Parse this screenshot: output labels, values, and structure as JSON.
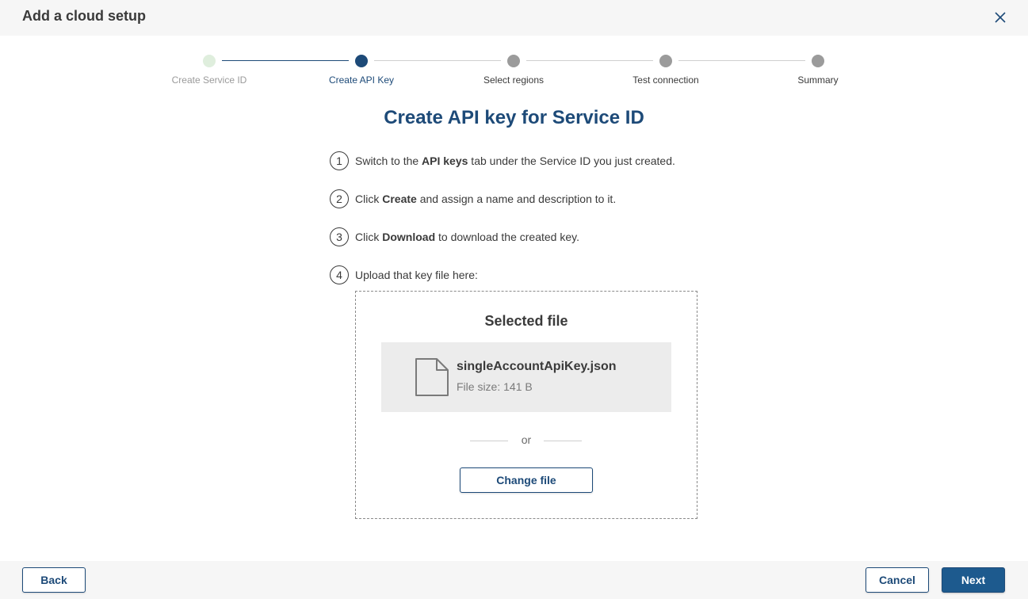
{
  "header": {
    "title": "Add a cloud setup",
    "close_icon": "close-icon"
  },
  "stepper": {
    "steps": [
      {
        "label": "Create Service ID",
        "state": "done"
      },
      {
        "label": "Create API Key",
        "state": "active"
      },
      {
        "label": "Select regions",
        "state": "pending"
      },
      {
        "label": "Test connection",
        "state": "pending"
      },
      {
        "label": "Summary",
        "state": "pending"
      }
    ]
  },
  "main": {
    "title": "Create API key for Service ID",
    "instructions": [
      {
        "number": "1",
        "pre": "Switch to the ",
        "bold": "API keys",
        "post": " tab under the Service ID you just created."
      },
      {
        "number": "2",
        "pre": "Click ",
        "bold": "Create",
        "post": " and assign a name and description to it."
      },
      {
        "number": "3",
        "pre": "Click ",
        "bold": "Download",
        "post": " to download the created key."
      },
      {
        "number": "4",
        "pre": "Upload that key file here:",
        "bold": "",
        "post": ""
      }
    ],
    "upload": {
      "title": "Selected file",
      "file_icon": "file-icon",
      "file_name": "singleAccountApiKey.json",
      "file_size": "File size: 141 B",
      "or_text": "or",
      "change_button": "Change file"
    }
  },
  "footer": {
    "back_label": "Back",
    "cancel_label": "Cancel",
    "next_label": "Next"
  },
  "colors": {
    "accent": "#1d4a78",
    "primary_button": "#1d5a8e",
    "done_step": "#dfeedd",
    "pending_step": "#9b9b9b"
  }
}
